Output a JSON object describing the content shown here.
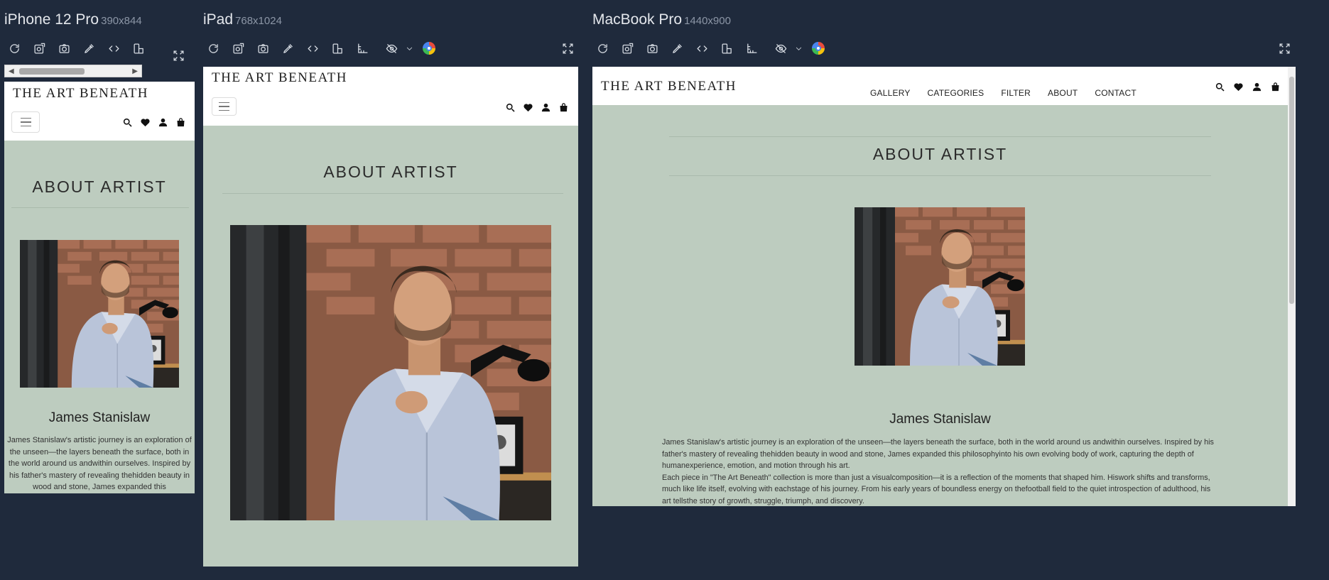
{
  "devices": [
    {
      "name": "iPhone 12 Pro",
      "dims": "390x844"
    },
    {
      "name": "iPad",
      "dims": "768x1024"
    },
    {
      "name": "MacBook Pro",
      "dims": "1440x900"
    }
  ],
  "toolbar_icons": [
    "refresh-icon",
    "screenshot-full-icon",
    "camera-icon",
    "eyedropper-icon",
    "code-icon",
    "rotate-device-icon",
    "ruler-icon",
    "hide-icon",
    "chevron-down-icon",
    "color-picker-icon",
    "fullscreen-icon"
  ],
  "site": {
    "brand": "THE ART BENEATH",
    "nav": [
      "GALLERY",
      "CATEGORIES",
      "FILTER",
      "ABOUT",
      "CONTACT"
    ],
    "header_icons": [
      "search-icon",
      "heart-icon",
      "user-icon",
      "bag-icon"
    ],
    "section_title": "ABOUT ARTIST",
    "artist_name": "James Stanislaw",
    "bio_phone": "James Stanislaw's artistic journey is an exploration of the unseen—the layers beneath the surface, both in the world around us andwithin ourselves. Inspired by his father's mastery of revealing thehidden beauty in wood and stone, James expanded this",
    "bio_p1": "James Stanislaw's artistic journey is an exploration of the unseen—the layers beneath the surface, both in the world around us andwithin ourselves. Inspired by his father's mastery of revealing thehidden beauty in wood and stone, James expanded this philosophyinto his own evolving body of work, capturing the depth of humanexperience, emotion, and motion through his art.",
    "bio_p2": "Each piece in \"The Art Beneath\" collection is more than just a visualcomposition—it is a reflection of the moments that shaped him. Hiswork shifts and transforms, much like life itself, evolving with eachstage of his journey. From his early years of boundless energy on thefootball field to the quiet introspection of adulthood, his art tellsthe story of growth, struggle, triumph, and discovery."
  },
  "colors": {
    "app_bg": "#1f2a3c",
    "page_bg": "#bdccbf",
    "header_bg": "#ffffff"
  }
}
